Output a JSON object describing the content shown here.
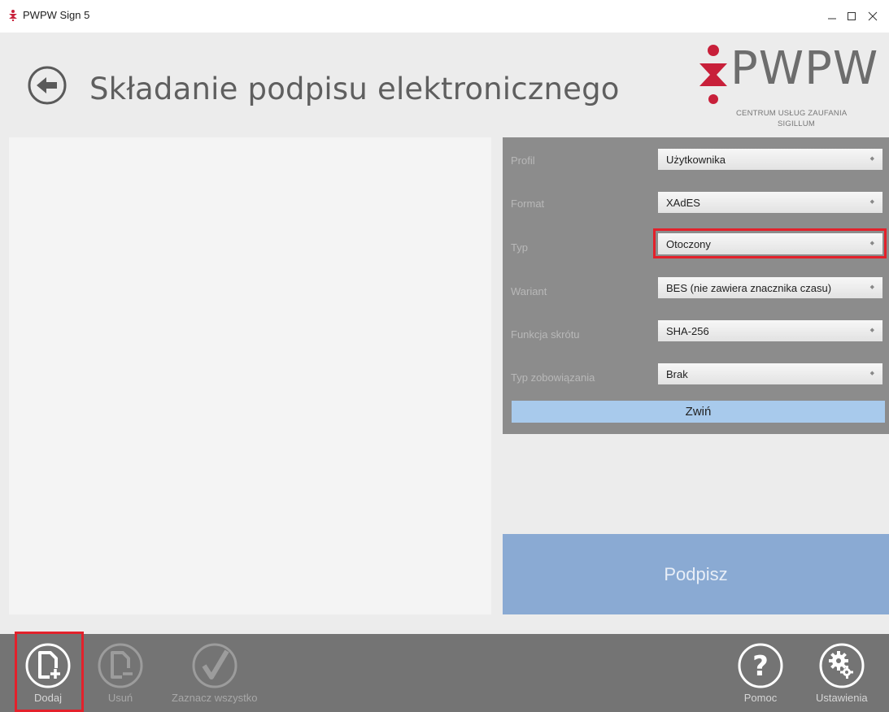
{
  "window": {
    "title": "PWPW Sign 5"
  },
  "header": {
    "title": "Składanie podpisu elektronicznego"
  },
  "logo": {
    "word": "PWPW",
    "sub1": "CENTRUM USŁUG ZAUFANIA",
    "sub2": "SIGILLUM"
  },
  "settings": {
    "rows": [
      {
        "label": "Profil",
        "value": "Użytkownika"
      },
      {
        "label": "Format",
        "value": "XAdES"
      },
      {
        "label": "Typ",
        "value": "Otoczony"
      },
      {
        "label": "Wariant",
        "value": "BES (nie zawiera znacznika czasu)"
      },
      {
        "label": "Funkcja skrótu",
        "value": "SHA-256"
      },
      {
        "label": "Typ zobowiązania",
        "value": "Brak"
      }
    ],
    "collapse_label": "Zwiń"
  },
  "sign_label": "Podpisz",
  "toolbar": {
    "add": "Dodaj",
    "remove": "Usuń",
    "select_all": "Zaznacz wszystko",
    "help": "Pomoc",
    "settings": "Ustawienia"
  },
  "colors": {
    "brand_red": "#c8203a",
    "highlight": "#e3212b",
    "sign": "#8aaad3",
    "collapse": "#a8caec"
  }
}
